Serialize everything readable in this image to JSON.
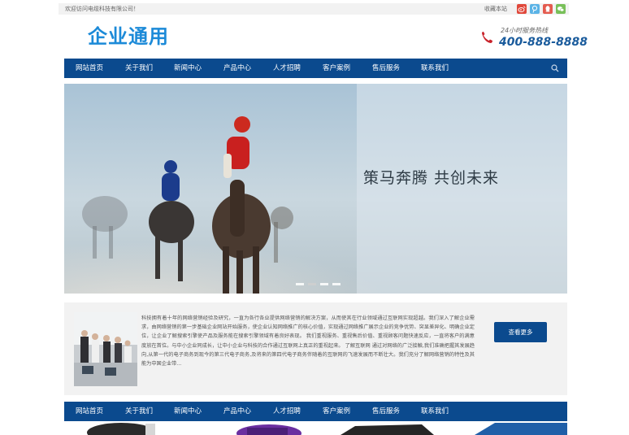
{
  "topbar": {
    "welcome": "欢迎访问电缆科技有限公司！",
    "favorite": "收藏本站",
    "social_icons": [
      "weibo-icon",
      "tencent-weibo-icon",
      "qq-icon",
      "wechat-icon"
    ]
  },
  "header": {
    "logo": "企业通用",
    "hotline_label": "24小时服务热线",
    "hotline_number": "400-888-8888"
  },
  "nav": {
    "items": [
      "网站首页",
      "关于我们",
      "新闻中心",
      "产品中心",
      "人才招聘",
      "客户案例",
      "售后服务",
      "联系我们"
    ]
  },
  "banner": {
    "slogan": "策马奔腾 共创未来",
    "slide_count": 4,
    "active_slide": 1
  },
  "about": {
    "text": "科技拥有着十年的网络营销经验及研究，一直为各行各业提供网络营销的解决方案，从而使其在行业领域通过互联网实现超越。我们深入了解企业需求，由网络营销的第一步基础企业网站开始服务，使企业认知网络推广的核心价值，实现通过网络推广展示企业的竞争优势、突显差异化、明确企业定位，让企业了解搜索引擎使产品及服务能在搜索引擎领域有着良好表现。 我们重视服务、重视售后价值、重视顾客问题快速反应，一直将客户的满意度放在首位。与中小企业同成长，让中小企业与科技的合作通过互联网上真正的重视起来。 了解互联网 通过对网络的广泛接触,我们准确把握其发展趋向,从第一代的电子商务到现今的第三代电子商务,及将来的第四代电子商务伴随着的互联网的飞速发展而不断壮大。我们充分了解网络营销的特性及其能为中国企业带...",
    "more_button": "查看更多"
  },
  "colors": {
    "nav_bg": "#0b4a8e",
    "logo": "#1c8ad8",
    "hotline": "#1a5b9c",
    "topbar_bg": "#f2f2f2"
  }
}
